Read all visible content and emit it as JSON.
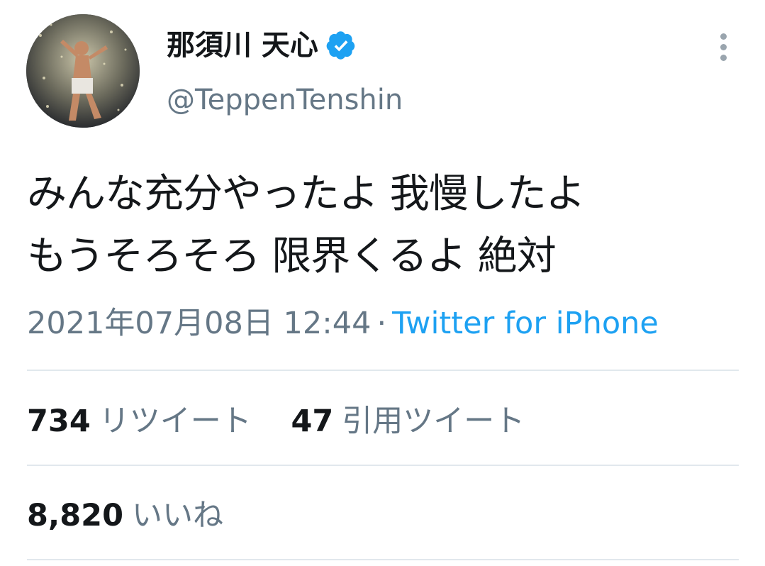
{
  "user": {
    "display_name": "那須川 天心",
    "handle": "@TeppenTenshin",
    "verified_icon": "verified-badge-icon",
    "avatar_icon": "profile-photo"
  },
  "tweet": {
    "lines": [
      "みんな充分やったよ 我慢したよ",
      "もうそろそろ 限界くるよ 絶対"
    ],
    "timestamp": "2021年07月08日 12:44",
    "separator": "·",
    "source": "Twitter for iPhone"
  },
  "stats": {
    "retweets": {
      "count": "734",
      "label": "リツイート"
    },
    "quotes": {
      "count": "47",
      "label": "引用ツイート"
    },
    "likes": {
      "count": "8,820",
      "label": "いいね"
    }
  },
  "colors": {
    "text": "#14171a",
    "secondary": "#657786",
    "link": "#1da1f2",
    "divider": "#e1e8ed",
    "verified": "#1da1f2"
  },
  "icons": {
    "more": "more-vertical-icon"
  }
}
